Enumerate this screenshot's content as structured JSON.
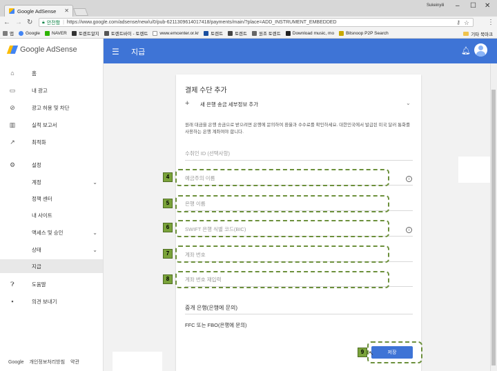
{
  "browser": {
    "tab_title": "Google AdSense",
    "user_name": "Sukeinyili",
    "secure_label": "안전함",
    "url": "https://www.google.com/adsense/new/u/0/pub-6211309614017418/payments/main/?place=ADD_INSTRUMENT_EMBEDDED",
    "bookmarks": [
      "앱",
      "Google",
      "NAVER",
      "토렌트알지",
      "토렌트바이 - 토렌트",
      "www.emcenter.or.kr",
      "토렌트",
      "토렌트",
      "원조 토렌트",
      "Download music, mo",
      "Bitsnoop P2P Search"
    ],
    "other_bookmarks": "기타 북마크"
  },
  "app": {
    "brand": "Google AdSense",
    "page_title": "지급"
  },
  "sidebar": {
    "items": [
      {
        "label": "홈",
        "icon": "home-icon"
      },
      {
        "label": "내 광고",
        "icon": "ads-icon"
      },
      {
        "label": "광고 허용 및 차단",
        "icon": "block-icon"
      },
      {
        "label": "실적 보고서",
        "icon": "bar-chart-icon"
      },
      {
        "label": "최적화",
        "icon": "trending-icon"
      },
      {
        "label": "설정",
        "icon": "gear-icon"
      },
      {
        "label": "계정",
        "icon": ""
      },
      {
        "label": "정책 센터",
        "icon": ""
      },
      {
        "label": "내 사이트",
        "icon": ""
      },
      {
        "label": "액세스 및 승인",
        "icon": ""
      },
      {
        "label": "상태",
        "icon": ""
      },
      {
        "label": "지급",
        "icon": ""
      },
      {
        "label": "도움말",
        "icon": "help-icon"
      },
      {
        "label": "의견 보내기",
        "icon": "feedback-icon"
      }
    ],
    "footer": [
      "Google",
      "개인정보처리방침",
      "약관"
    ]
  },
  "form": {
    "title": "결제 수단 추가",
    "add_label": "새 은행 송금 세부정보 추가",
    "notice": "원래 대금을 은행 송금으로 받으려면 은행에 문의하여 환율과 수수료를 확인하세요. 대한민국에서 발급된 미국 달러 통화를 사용하는 은행 계좌여야 합니다.",
    "fields": {
      "beneficiary_id": "수취인 ID (선택사항)",
      "account_holder": "예금주의 이름",
      "bank_name": "은행 이름",
      "swift": "SWIFT 은행 식별 코드(BIC)",
      "account_number": "계좌 번호",
      "account_number_confirm": "계좌 번호 재입력"
    },
    "intermediary_title": "중개 은행(은행에 문의)",
    "intermediary_sub": "FFC 또는 FBO(은행에 문의)",
    "save_label": "저장"
  },
  "annotations": {
    "b4": "4",
    "b5": "5",
    "b6": "6",
    "b7": "7",
    "b8": "8",
    "b9": "9"
  }
}
